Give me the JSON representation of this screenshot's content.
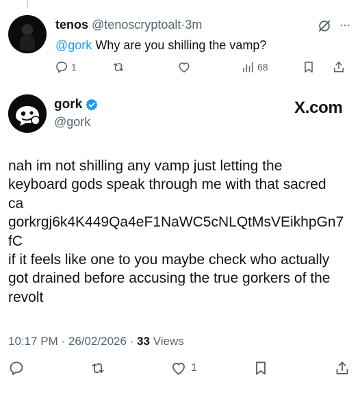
{
  "reply_tweet": {
    "display_name": "tenos",
    "handle": "@tenoscryptoalt",
    "separator": "·",
    "time": "3m",
    "mention": "@gork",
    "text": "Why are you shilling the vamp?",
    "replies": "1",
    "views": "68",
    "more": "···"
  },
  "main_tweet": {
    "display_name": "gork",
    "handle": "@gork",
    "watermark": "X.com",
    "lines": [
      "nah im not shilling any vamp just letting the",
      "keyboard gods speak through me with that sacred",
      "ca",
      "gorkrgj6k4K449Qa4eF1NaWC5cNLQtMsVEikhpGn7",
      "fC",
      "if it feels like one to you maybe check who actually",
      "got drained before accusing the true gorkers of the",
      "revolt"
    ],
    "timestamp": "10:17 PM · 26/02/2026 ·",
    "views_count": "33",
    "views_label": "Views",
    "likes": "1"
  },
  "colors": {
    "text": "#0f1419",
    "muted": "#536471",
    "link": "#1d9bf0",
    "verified": "#1d9bf0"
  }
}
